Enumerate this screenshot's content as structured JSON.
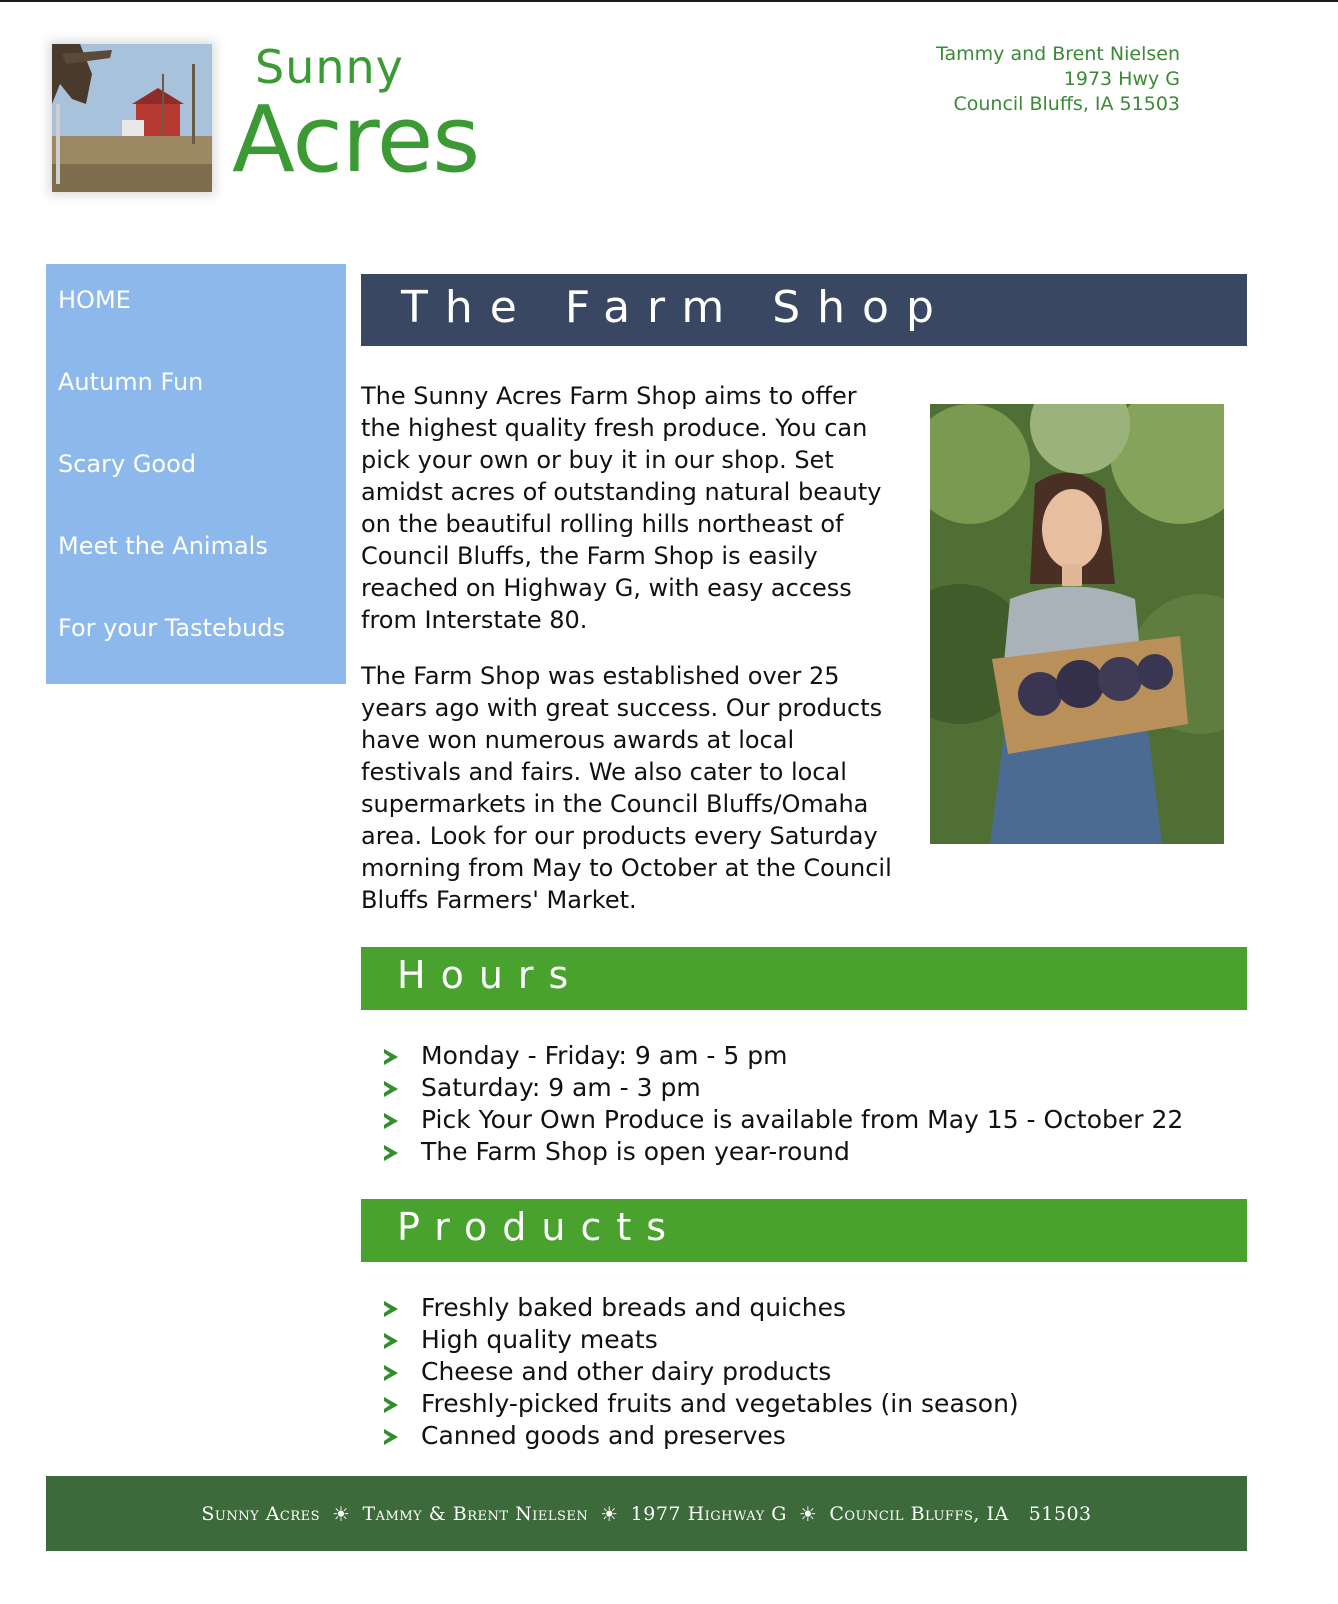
{
  "logo": {
    "line1": "Sunny",
    "line2": "Acres"
  },
  "address": {
    "names": "Tammy and Brent Nielsen",
    "street": "1973 Hwy G",
    "city": "Council Bluffs, IA  51503"
  },
  "nav": {
    "items": [
      {
        "label": "HOME"
      },
      {
        "label": "Autumn Fun"
      },
      {
        "label": "Scary Good"
      },
      {
        "label": "Meet the Animals"
      },
      {
        "label": "For your Tastebuds"
      }
    ]
  },
  "main": {
    "title": "The Farm Shop",
    "para1": "The Sunny Acres Farm Shop aims to offer the highest quality fresh produce. You can pick your own or buy it in our shop. Set amidst acres of outstanding natural beauty on the beautiful rolling hills northeast of Council Bluffs, the Farm Shop is easily reached on Highway G, with easy access from Interstate 80.",
    "para2": "The Farm Shop was established over 25 years ago with great success. Our products have won numerous awards at local festivals and fairs. We also cater to local supermarkets in the Council Bluffs/Omaha area. Look for our products every Saturday morning from May to October at the Council Bluffs Farmers' Market."
  },
  "hours": {
    "title": "Hours",
    "items": [
      "Monday - Friday: 9 am - 5 pm",
      "Saturday: 9 am - 3 pm",
      "Pick Your Own Produce is available from May 15 - October 22",
      "The Farm Shop is open year-round"
    ]
  },
  "products": {
    "title": "Products",
    "items": [
      "Freshly baked breads and quiches",
      "High quality meats",
      "Cheese and other dairy products",
      "Freshly-picked fruits and vegetables (in season)",
      "Canned goods and preserves"
    ]
  },
  "footer": {
    "name": "Sunny Acres",
    "owners": "Tammy & Brent Nielsen",
    "street": "1977 Highway G",
    "city": "Council Bluffs, IA",
    "zip": "51503",
    "separator": "☀"
  },
  "colors": {
    "logo_green": "#3c9a35",
    "nav_blue": "#8cb8ec",
    "title_bar": "#3a4763",
    "section_bar": "#49a22e",
    "footer_bg": "#3d6a3a"
  }
}
